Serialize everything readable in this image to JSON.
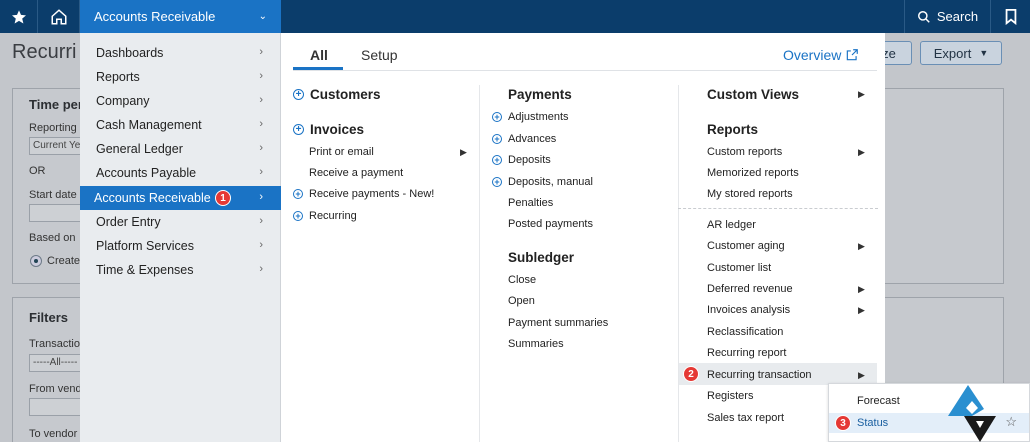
{
  "topbar": {
    "module": "Accounts Receivable",
    "search_label": "Search"
  },
  "background": {
    "page_title": "Recurri",
    "customize_partial": "ze",
    "export_label": "Export",
    "panel1": {
      "heading": "Time peri",
      "reporting_label": "Reporting",
      "reporting_value": "Current Ye",
      "or_label": "OR",
      "start_date_label": "Start date",
      "based_on_label": "Based on",
      "radio_label": "Create"
    },
    "panel2": {
      "heading": "Filters",
      "transaction_label": "Transaction",
      "transaction_value": "-----All-----",
      "from_vendor_label": "From vendo",
      "to_vendor_label": "To vendor"
    }
  },
  "left_menu": {
    "items": [
      {
        "label": "Dashboards"
      },
      {
        "label": "Reports"
      },
      {
        "label": "Company"
      },
      {
        "label": "Cash Management"
      },
      {
        "label": "General Ledger"
      },
      {
        "label": "Accounts Payable"
      },
      {
        "label": "Accounts Receivable",
        "badge": "1"
      },
      {
        "label": "Order Entry"
      },
      {
        "label": "Platform Services"
      },
      {
        "label": "Time & Expenses"
      }
    ]
  },
  "mega": {
    "tabs": [
      {
        "label": "All"
      },
      {
        "label": "Setup"
      }
    ],
    "overview": "Overview",
    "col1": {
      "customers": "Customers",
      "invoices": "Invoices",
      "print_or_email": "Print or email",
      "receive_payment": "Receive a payment",
      "receive_payments_new": "Receive payments - New!",
      "recurring": "Recurring"
    },
    "col2": {
      "payments": "Payments",
      "adjustments": "Adjustments",
      "advances": "Advances",
      "deposits": "Deposits",
      "deposits_manual": "Deposits, manual",
      "penalties": "Penalties",
      "posted_payments": "Posted payments",
      "subledger": "Subledger",
      "close": "Close",
      "open": "Open",
      "payment_summaries": "Payment summaries",
      "summaries": "Summaries"
    },
    "col3": {
      "custom_views": "Custom Views",
      "reports": "Reports",
      "custom_reports": "Custom reports",
      "memorized_reports": "Memorized reports",
      "my_stored_reports": "My stored reports",
      "ar_ledger": "AR ledger",
      "customer_aging": "Customer aging",
      "customer_list": "Customer list",
      "deferred_revenue": "Deferred revenue",
      "invoices_analysis": "Invoices analysis",
      "reclassification": "Reclassification",
      "recurring_report": "Recurring report",
      "recurring_transaction": "Recurring transaction",
      "recurring_badge": "2",
      "registers": "Registers",
      "sales_tax_report": "Sales tax report"
    }
  },
  "flyout": {
    "forecast": "Forecast",
    "status": "Status",
    "status_badge": "3"
  },
  "colors": {
    "topbar": "#0b3d6b",
    "accent": "#1a73c5",
    "badge": "#e53935"
  }
}
